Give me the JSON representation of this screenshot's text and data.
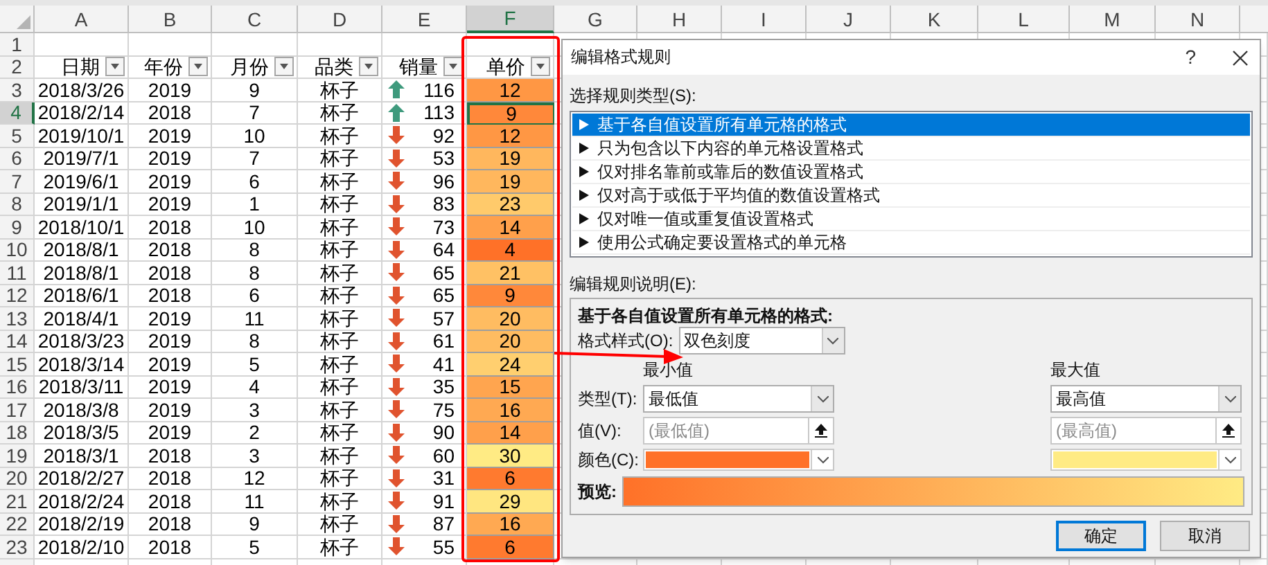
{
  "sheet": {
    "columns": [
      {
        "label": "A",
        "selected": false
      },
      {
        "label": "B",
        "selected": false
      },
      {
        "label": "C",
        "selected": false
      },
      {
        "label": "D",
        "selected": false
      },
      {
        "label": "E",
        "selected": false
      },
      {
        "label": "F",
        "selected": true
      },
      {
        "label": "G",
        "selected": false
      },
      {
        "label": "H",
        "selected": false
      },
      {
        "label": "I",
        "selected": false
      },
      {
        "label": "J",
        "selected": false
      },
      {
        "label": "K",
        "selected": false
      },
      {
        "label": "L",
        "selected": false
      },
      {
        "label": "M",
        "selected": false
      },
      {
        "label": "N",
        "selected": false
      }
    ],
    "blank_row": {
      "number": "1"
    },
    "header_row": {
      "number": "2",
      "cells": [
        "日期",
        "年份",
        "月份",
        "品类",
        "销量",
        "单价"
      ]
    },
    "rows": [
      {
        "number": "3",
        "selected": false,
        "date": "2018/3/26",
        "year": "2019",
        "month": "9",
        "category": "杯子",
        "sales": {
          "kind": "up",
          "value": "116"
        },
        "price": {
          "value": "12",
          "color": "#ff9744"
        }
      },
      {
        "number": "4",
        "selected": true,
        "date": "2018/2/14",
        "year": "2018",
        "month": "7",
        "category": "杯子",
        "sales": {
          "kind": "up",
          "value": "113"
        },
        "price": {
          "value": "9",
          "color": "#ff883a"
        }
      },
      {
        "number": "5",
        "selected": false,
        "date": "2019/10/1",
        "year": "2019",
        "month": "10",
        "category": "杯子",
        "sales": {
          "kind": "down",
          "value": "92"
        },
        "price": {
          "value": "12",
          "color": "#ff9744"
        }
      },
      {
        "number": "6",
        "selected": false,
        "date": "2019/7/1",
        "year": "2019",
        "month": "7",
        "category": "杯子",
        "sales": {
          "kind": "down",
          "value": "53"
        },
        "price": {
          "value": "19",
          "color": "#ffb75d"
        }
      },
      {
        "number": "7",
        "selected": false,
        "date": "2019/6/1",
        "year": "2019",
        "month": "6",
        "category": "杯子",
        "sales": {
          "kind": "down",
          "value": "96"
        },
        "price": {
          "value": "19",
          "color": "#ffb75d"
        }
      },
      {
        "number": "8",
        "selected": false,
        "date": "2019/1/1",
        "year": "2019",
        "month": "1",
        "category": "杯子",
        "sales": {
          "kind": "down",
          "value": "83"
        },
        "price": {
          "value": "23",
          "color": "#ffca6b"
        }
      },
      {
        "number": "9",
        "selected": false,
        "date": "2018/10/1",
        "year": "2018",
        "month": "10",
        "category": "杯子",
        "sales": {
          "kind": "down",
          "value": "73"
        },
        "price": {
          "value": "14",
          "color": "#ffa04b"
        }
      },
      {
        "number": "10",
        "selected": false,
        "date": "2018/8/1",
        "year": "2018",
        "month": "8",
        "category": "杯子",
        "sales": {
          "kind": "down",
          "value": "64"
        },
        "price": {
          "value": "4",
          "color": "#ff7128"
        }
      },
      {
        "number": "11",
        "selected": false,
        "date": "2018/8/1",
        "year": "2018",
        "month": "8",
        "category": "杯子",
        "sales": {
          "kind": "down",
          "value": "65"
        },
        "price": {
          "value": "21",
          "color": "#ffc164"
        }
      },
      {
        "number": "12",
        "selected": false,
        "date": "2018/6/1",
        "year": "2018",
        "month": "6",
        "category": "杯子",
        "sales": {
          "kind": "down",
          "value": "65"
        },
        "price": {
          "value": "9",
          "color": "#ff883a"
        }
      },
      {
        "number": "13",
        "selected": false,
        "date": "2018/4/1",
        "year": "2019",
        "month": "11",
        "category": "杯子",
        "sales": {
          "kind": "down",
          "value": "57"
        },
        "price": {
          "value": "20",
          "color": "#ffbc61"
        }
      },
      {
        "number": "14",
        "selected": false,
        "date": "2018/3/23",
        "year": "2019",
        "month": "8",
        "category": "杯子",
        "sales": {
          "kind": "down",
          "value": "61"
        },
        "price": {
          "value": "20",
          "color": "#ffbc61"
        }
      },
      {
        "number": "15",
        "selected": false,
        "date": "2018/3/14",
        "year": "2019",
        "month": "5",
        "category": "杯子",
        "sales": {
          "kind": "down",
          "value": "41"
        },
        "price": {
          "value": "24",
          "color": "#ffcf6f"
        }
      },
      {
        "number": "16",
        "selected": false,
        "date": "2018/3/11",
        "year": "2019",
        "month": "4",
        "category": "杯子",
        "sales": {
          "kind": "down",
          "value": "35"
        },
        "price": {
          "value": "15",
          "color": "#ffa54f"
        }
      },
      {
        "number": "17",
        "selected": false,
        "date": "2018/3/8",
        "year": "2019",
        "month": "3",
        "category": "杯子",
        "sales": {
          "kind": "down",
          "value": "75"
        },
        "price": {
          "value": "16",
          "color": "#ffa952"
        }
      },
      {
        "number": "18",
        "selected": false,
        "date": "2018/3/5",
        "year": "2019",
        "month": "2",
        "category": "杯子",
        "sales": {
          "kind": "down",
          "value": "90"
        },
        "price": {
          "value": "14",
          "color": "#ffa04b"
        }
      },
      {
        "number": "19",
        "selected": false,
        "date": "2018/3/1",
        "year": "2018",
        "month": "3",
        "category": "杯子",
        "sales": {
          "kind": "down",
          "value": "60"
        },
        "price": {
          "value": "30",
          "color": "#ffeb84"
        }
      },
      {
        "number": "20",
        "selected": false,
        "date": "2018/2/27",
        "year": "2018",
        "month": "12",
        "category": "杯子",
        "sales": {
          "kind": "down",
          "value": "31"
        },
        "price": {
          "value": "6",
          "color": "#ff7a2f"
        }
      },
      {
        "number": "21",
        "selected": false,
        "date": "2018/2/24",
        "year": "2018",
        "month": "11",
        "category": "杯子",
        "sales": {
          "kind": "down",
          "value": "91"
        },
        "price": {
          "value": "29",
          "color": "#ffe680"
        }
      },
      {
        "number": "22",
        "selected": false,
        "date": "2018/2/19",
        "year": "2018",
        "month": "9",
        "category": "杯子",
        "sales": {
          "kind": "down",
          "value": "87"
        },
        "price": {
          "value": "16",
          "color": "#ffa952"
        }
      },
      {
        "number": "23",
        "selected": false,
        "date": "2018/2/10",
        "year": "2018",
        "month": "5",
        "category": "杯子",
        "sales": {
          "kind": "down",
          "value": "55"
        },
        "price": {
          "value": "6",
          "color": "#ff7a2f"
        }
      }
    ]
  },
  "dialog": {
    "title": "编辑格式规则",
    "help": "?",
    "rule_type_label": "选择规则类型(S):",
    "rule_types": [
      {
        "label": "基于各自值设置所有单元格的格式",
        "selected": true
      },
      {
        "label": "只为包含以下内容的单元格设置格式",
        "selected": false
      },
      {
        "label": "仅对排名靠前或靠后的数值设置格式",
        "selected": false
      },
      {
        "label": "仅对高于或低于平均值的数值设置格式",
        "selected": false
      },
      {
        "label": "仅对唯一值或重复值设置格式",
        "selected": false
      },
      {
        "label": "使用公式确定要设置格式的单元格",
        "selected": false
      }
    ],
    "description_label": "编辑规则说明(E):",
    "description": {
      "heading": "基于各自值设置所有单元格的格式:",
      "style_label": "格式样式(O):",
      "style_value": "双色刻度",
      "type_label": "类型(T):",
      "value_label": "值(V):",
      "color_label": "颜色(C):",
      "preview_label": "预览:",
      "min": {
        "heading": "最小值",
        "type": "最低值",
        "value_placeholder": "(最低值)",
        "color": "#ff7128"
      },
      "max": {
        "heading": "最大值",
        "type": "最高值",
        "value_placeholder": "(最高值)",
        "color": "#ffeb84"
      }
    },
    "buttons": [
      {
        "label": "确定",
        "default": true
      },
      {
        "label": "取消",
        "default": false
      }
    ]
  }
}
